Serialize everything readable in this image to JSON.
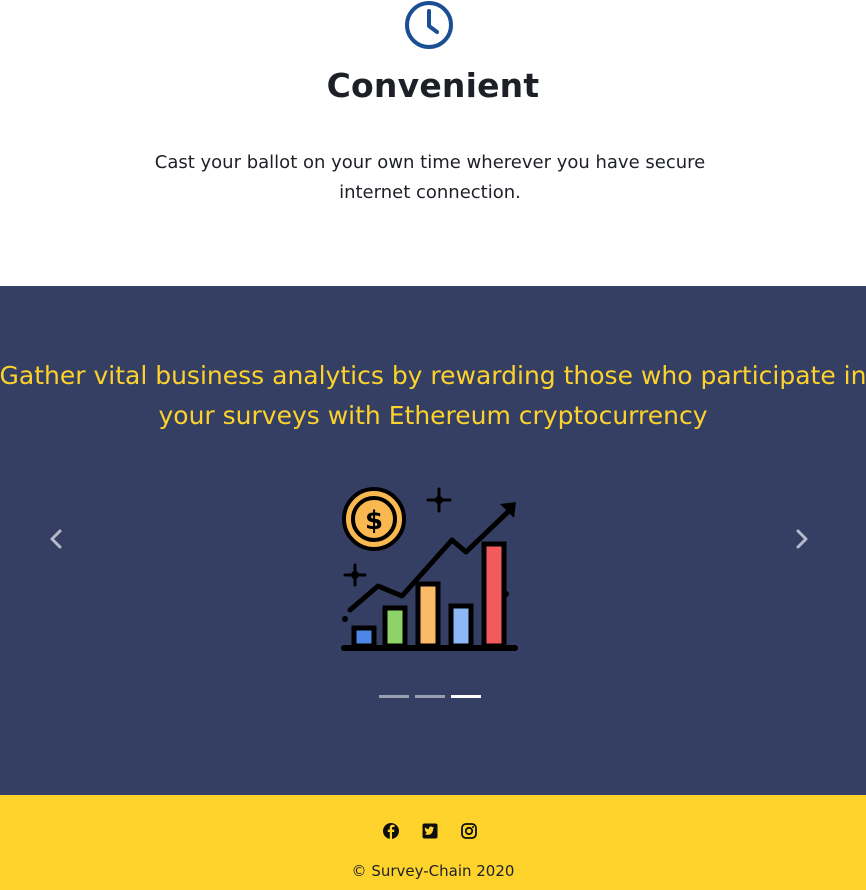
{
  "feature": {
    "icon": "clock-icon",
    "title": "Convenient",
    "description": "Cast your ballot on your own time wherever you have secure internet connection."
  },
  "carousel": {
    "headline_line1": "Gather vital business analytics by rewarding those who participate in",
    "headline_line2": "your surveys with Ethereum cryptocurrency",
    "image_icon": "growth-chart-dollar-icon",
    "prev_icon": "chevron-left-icon",
    "next_icon": "chevron-right-icon",
    "slide_count": 3,
    "active_slide": 3
  },
  "footer": {
    "social": [
      "facebook-icon",
      "twitter-icon",
      "instagram-icon"
    ],
    "copyright": "© Survey-Chain 2020"
  },
  "colors": {
    "navy": "#353f63",
    "accent_yellow": "#fdd22c",
    "icon_blue": "#1a4f93"
  }
}
